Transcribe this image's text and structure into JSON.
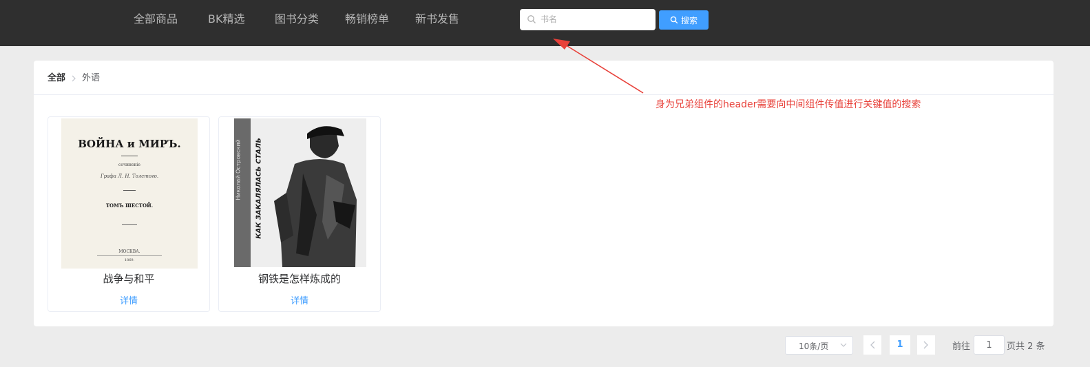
{
  "nav": {
    "items": [
      "全部商品",
      "BK精选",
      "图书分类",
      "畅销榜单",
      "新书发售"
    ]
  },
  "search": {
    "placeholder": "书名",
    "value": "",
    "button_label": "搜索",
    "icon": "search-icon"
  },
  "breadcrumb": {
    "root": "全部",
    "separator": ">",
    "current": "外语"
  },
  "books": [
    {
      "title": "战争与和平",
      "link": "详情",
      "cover": {
        "heading": "ВОЙНА и МИРЪ.",
        "subtitle": "сочиненіе",
        "author": "Графа Л. Н. Толстого.",
        "volume": "ТОМЪ ШЕСТОЙ.",
        "city": "МОСКВА.",
        "year": "1869."
      }
    },
    {
      "title": "钢铁是怎样炼成的",
      "link": "详情",
      "cover": {
        "author": "Николай Островский",
        "heading": "КАК ЗАКАЛЯЛАСЬ СТАЛЬ"
      }
    }
  ],
  "annotation": {
    "text": "身为兄弟组件的header需要向中间组件传值进行关键值的搜索",
    "color": "#e8413a"
  },
  "pagination": {
    "page_size": "10条/页",
    "current_page": "1",
    "goto_label": "前往",
    "goto_value": "1",
    "total_label": "页共 2 条"
  },
  "colors": {
    "topbar": "#2f2f2f",
    "accent": "#409eff",
    "background": "#ececec"
  }
}
